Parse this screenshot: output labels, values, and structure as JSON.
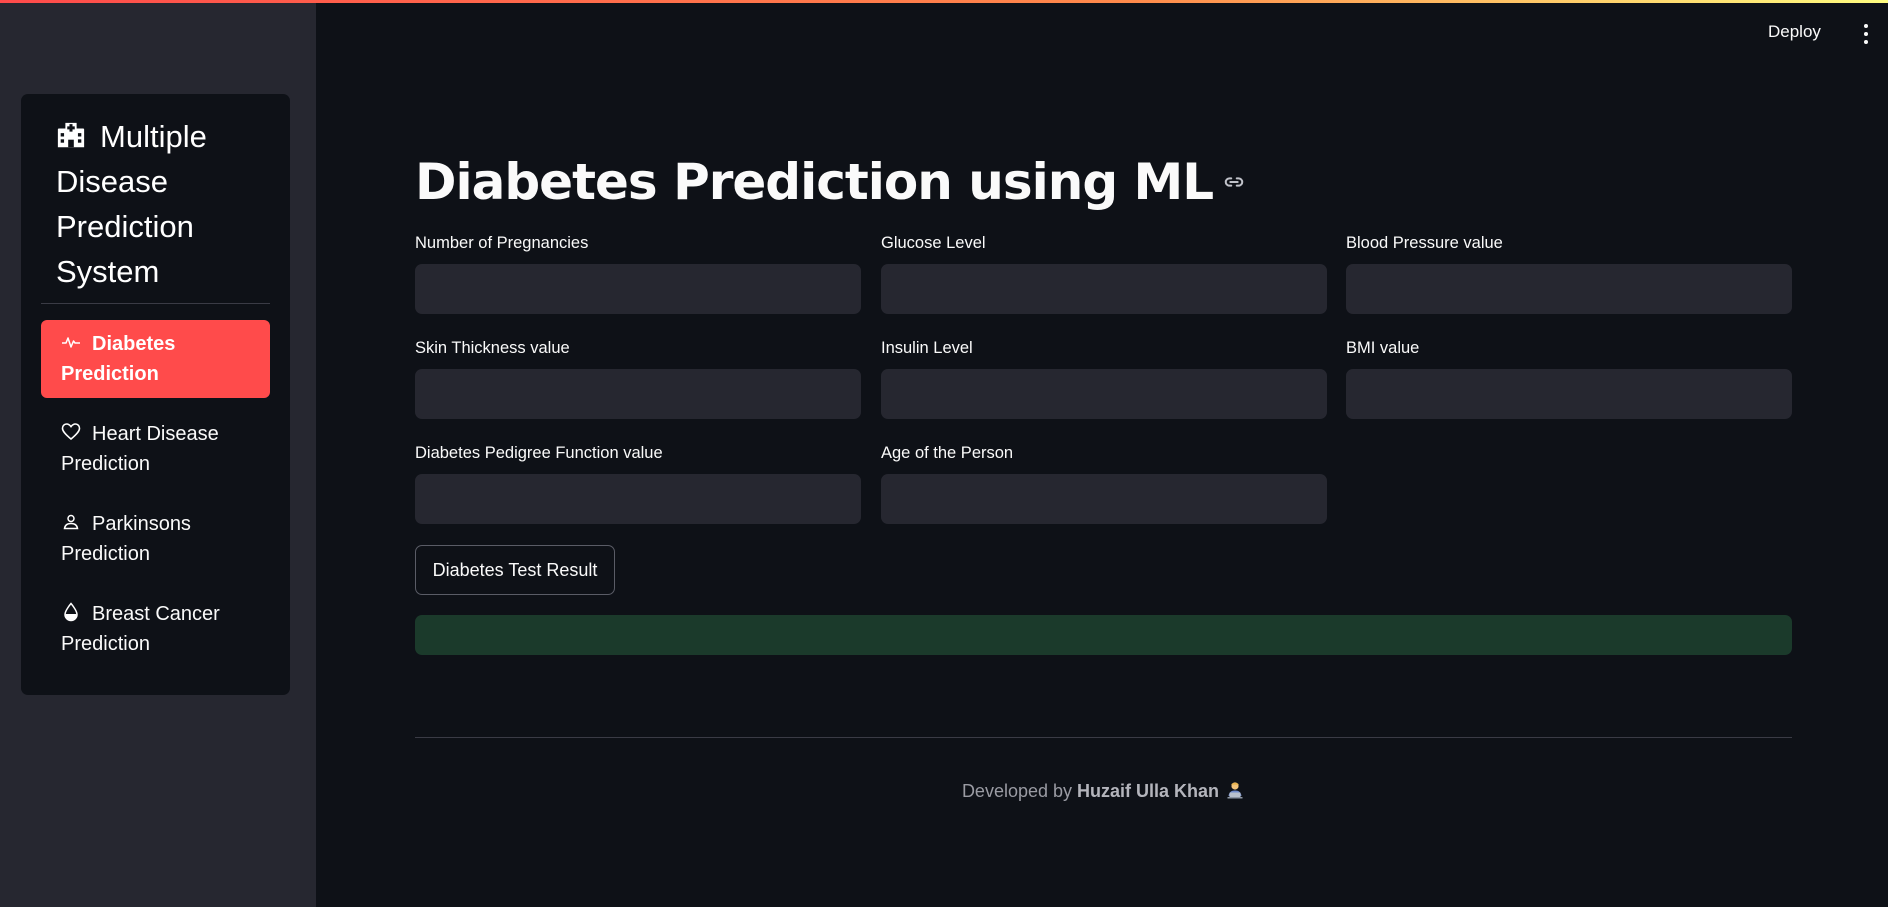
{
  "header": {
    "deploy_label": "Deploy",
    "menu_icon": "kebab-menu-icon"
  },
  "sidebar": {
    "title": "Multiple Disease Prediction System",
    "title_icon": "hospital-icon",
    "items": [
      {
        "label": "Diabetes Prediction",
        "icon": "activity-icon",
        "active": true
      },
      {
        "label": "Heart Disease Prediction",
        "icon": "heart-icon",
        "active": false
      },
      {
        "label": "Parkinsons Prediction",
        "icon": "person-icon",
        "active": false
      },
      {
        "label": "Breast Cancer Prediction",
        "icon": "droplet-icon",
        "active": false
      }
    ]
  },
  "main": {
    "title": "Diabetes Prediction using ML",
    "fields": [
      {
        "label": "Number of Pregnancies",
        "value": ""
      },
      {
        "label": "Glucose Level",
        "value": ""
      },
      {
        "label": "Blood Pressure value",
        "value": ""
      },
      {
        "label": "Skin Thickness value",
        "value": ""
      },
      {
        "label": "Insulin Level",
        "value": ""
      },
      {
        "label": "BMI value",
        "value": ""
      },
      {
        "label": "Diabetes Pedigree Function value",
        "value": ""
      },
      {
        "label": "Age of the Person",
        "value": ""
      }
    ],
    "button_label": "Diabetes Test Result",
    "result_text": ""
  },
  "footer": {
    "prefix": "Developed by",
    "author": "Huzaif Ulla Khan",
    "icon": "technologist-icon"
  },
  "colors": {
    "accent": "#ff4b4b",
    "background": "#0e1117",
    "sidebar": "#262730",
    "success": "#1b3a2b"
  }
}
